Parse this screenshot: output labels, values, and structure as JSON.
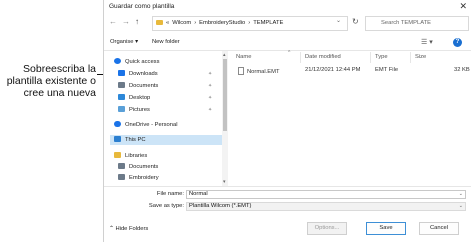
{
  "callout": {
    "lines": [
      "Sobreescriba la",
      "plantilla existente o",
      "cree una nueva"
    ]
  },
  "dialog": {
    "title": "Guardar como plantilla",
    "close_icon": "close-icon"
  },
  "navbar": {
    "back": "←",
    "forward": "→",
    "up": "↑",
    "path": [
      "«",
      "Wilcom",
      "›",
      "EmbroideryStudio",
      "›",
      "TEMPLATE"
    ],
    "refresh": "↻",
    "search_placeholder": "Search TEMPLATE"
  },
  "toolbar": {
    "organise": "Organise ▾",
    "new_folder": "New folder"
  },
  "sidebar": {
    "items": [
      {
        "label": "Quick access",
        "icon": "star-icon",
        "color": "#1a73e8",
        "pinned": false
      },
      {
        "label": "Downloads",
        "icon": "download-icon",
        "color": "#1a73e8",
        "pinned": true
      },
      {
        "label": "Documents",
        "icon": "documents-icon",
        "color": "#6c7a89",
        "pinned": true
      },
      {
        "label": "Desktop",
        "icon": "desktop-icon",
        "color": "#2c88d9",
        "pinned": true
      },
      {
        "label": "Pictures",
        "icon": "pictures-icon",
        "color": "#5aa0d8",
        "pinned": true
      },
      {
        "label": "OneDrive - Personal",
        "icon": "cloud-icon",
        "color": "#1a73e8",
        "pinned": false
      },
      {
        "label": "This PC",
        "icon": "pc-icon",
        "color": "#2b7fd0",
        "pinned": false
      },
      {
        "label": "Libraries",
        "icon": "libraries-icon",
        "color": "#e8b93c",
        "pinned": false
      },
      {
        "label": "Documents",
        "icon": "documents-icon",
        "color": "#6c7a89",
        "pinned": false
      },
      {
        "label": "Embroidery",
        "icon": "embroidery-icon",
        "color": "#6c7a89",
        "pinned": false
      }
    ]
  },
  "filelist": {
    "columns": [
      "Name",
      "Date modified",
      "Type",
      "Size"
    ],
    "rows": [
      {
        "name": "Normal.EMT",
        "date": "21/12/2021 12:44 PM",
        "type": "EMT File",
        "size": "32 KB"
      }
    ]
  },
  "form": {
    "file_name_label": "File name:",
    "file_name_value": "Normal",
    "save_type_label": "Save as type:",
    "save_type_value": "Plantilla Wilcom (*.EMT)"
  },
  "footer": {
    "hide_folders": "Hide Folders",
    "options": "Options...",
    "save": "Save",
    "cancel": "Cancel"
  }
}
